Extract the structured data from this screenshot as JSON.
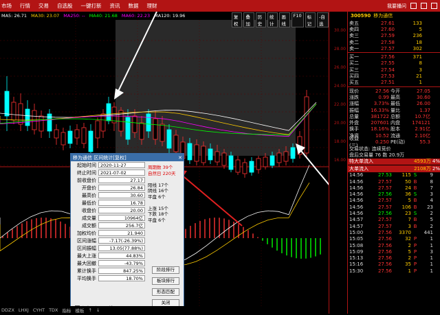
{
  "menu": [
    "市场",
    "行情",
    "交易",
    "自选股",
    "一键打新",
    "资讯",
    "数据",
    "理财"
  ],
  "topright": {
    "link": "我要播问"
  },
  "ma_legend": [
    {
      "text": "MA5: 26.71",
      "color": "#ffffff"
    },
    {
      "text": "MA30: 23.07",
      "color": "#ffcc00"
    },
    {
      "text": "MA250: --",
      "color": "#ff00ff"
    },
    {
      "text": "MA40: 21.68",
      "color": "#00ff00"
    },
    {
      "text": "MA60: 22.23",
      "color": "#ff00ff"
    },
    {
      "text": "MA120: 19.96",
      "color": "#ffffff"
    }
  ],
  "chart_buttons": [
    "复权",
    "叠加",
    "历史",
    "统计",
    "画线",
    "F10",
    "标记",
    "-自选"
  ],
  "axis_ticks": [
    "30.00",
    "28.00",
    "26.00",
    "24.00",
    "22.00",
    "20.00",
    "18.00",
    "16.00"
  ],
  "stock": {
    "code": "300590",
    "name": "移为通信"
  },
  "asks": [
    {
      "label": "卖五",
      "price": "27.61",
      "vol": "133"
    },
    {
      "label": "卖四",
      "price": "27.60",
      "vol": "5"
    },
    {
      "label": "卖三",
      "price": "27.59",
      "vol": "236"
    },
    {
      "label": "卖二",
      "price": "27.58",
      "vol": "18"
    },
    {
      "label": "卖一",
      "price": "27.57",
      "vol": "302"
    }
  ],
  "bids": [
    {
      "label": "买一",
      "price": "27.56",
      "vol": "371"
    },
    {
      "label": "买二",
      "price": "27.55",
      "vol": "8"
    },
    {
      "label": "买三",
      "price": "27.54",
      "vol": "3"
    },
    {
      "label": "买四",
      "price": "27.53",
      "vol": "21"
    },
    {
      "label": "买五",
      "price": "27.51",
      "vol": "1"
    }
  ],
  "quote": [
    {
      "a": "现价",
      "b": "27.56",
      "c": "今开",
      "d": "27.05"
    },
    {
      "a": "涨跌",
      "b": "0.99",
      "c": "最高",
      "d": "30.60"
    },
    {
      "a": "涨幅",
      "b": "3.73%",
      "c": "最低",
      "d": "26.00"
    },
    {
      "a": "振幅",
      "b": "16.33%",
      "c": "量比",
      "d": "1.37"
    },
    {
      "a": "总量",
      "b": "381722",
      "c": "总额",
      "d": "10.7亿"
    },
    {
      "a": "外盘",
      "b": "207601",
      "c": "内盘",
      "d": "174121"
    },
    {
      "a": "换手",
      "b": "18.16%",
      "c": "股本",
      "d": "2.91亿"
    },
    {
      "a": "净资",
      "b": "10.52",
      "c": "流通",
      "d": "2.10亿"
    },
    {
      "a": "收益(三)",
      "b": "0.250",
      "c": "PE(动)",
      "d": "55.3"
    }
  ],
  "status": {
    "line1": "交易状态: 连续竞价",
    "line2": "盘后交易量 76 数 20.9万"
  },
  "flow": [
    {
      "label": "特大单流入",
      "value": "4593万",
      "pct": "4%"
    },
    {
      "label": "大单流入",
      "value": "2108万",
      "pct": "2%"
    }
  ],
  "ticks": [
    {
      "t": "14:56",
      "p": "27.53",
      "v": "115",
      "k": "S",
      "n": "9"
    },
    {
      "t": "14:56",
      "p": "27.57",
      "v": "50",
      "k": "B",
      "n": "8"
    },
    {
      "t": "14:56",
      "p": "27.57",
      "v": "24",
      "k": "B",
      "n": "7"
    },
    {
      "t": "14:56",
      "p": "27.56",
      "v": "36",
      "k": "S",
      "n": "3"
    },
    {
      "t": "14:56",
      "p": "27.57",
      "v": "5",
      "k": "B",
      "n": "4"
    },
    {
      "t": "14:56",
      "p": "27.57",
      "v": "106",
      "k": "B",
      "n": "23"
    },
    {
      "t": "14:56",
      "p": "27.56",
      "v": "23",
      "k": "S",
      "n": "2"
    },
    {
      "t": "14:57",
      "p": "27.57",
      "v": "7",
      "k": "B",
      "n": "5"
    },
    {
      "t": "14:57",
      "p": "27.57",
      "v": "3",
      "k": "B",
      "n": "2"
    },
    {
      "t": "15:00",
      "p": "27.56",
      "v": "3370",
      "k": "",
      "n": "441"
    },
    {
      "t": "15:05",
      "p": "27.56",
      "v": "32",
      "k": "P",
      "n": "1"
    },
    {
      "t": "15:08",
      "p": "27.56",
      "v": "2",
      "k": "P",
      "n": "1"
    },
    {
      "t": "15:09",
      "p": "27.56",
      "v": "5",
      "k": "P",
      "n": "3"
    },
    {
      "t": "15:13",
      "p": "27.56",
      "v": "2",
      "k": "P",
      "n": "1"
    },
    {
      "t": "15:16",
      "p": "27.56",
      "v": "35",
      "k": "P",
      "n": "1"
    },
    {
      "t": "15:30",
      "p": "27.56",
      "v": "1",
      "k": "P",
      "n": "1"
    }
  ],
  "dialog": {
    "title": "移为通信 区间统计[复权]",
    "fields": [
      {
        "label": "起始时间",
        "value": "2020-11-27",
        "left": true
      },
      {
        "label": "终止时间",
        "value": "2021-07-02",
        "left": true
      },
      {
        "label": "前收盘价",
        "value": "27.17"
      },
      {
        "label": "开盘价",
        "value": "26.84"
      },
      {
        "label": "最高价",
        "value": "30.60"
      },
      {
        "label": "最低价",
        "value": "16.78"
      },
      {
        "label": "收盘价",
        "value": "20.00"
      },
      {
        "label": "成交量",
        "value": "10964亿"
      },
      {
        "label": "成交额",
        "value": "256.7亿"
      },
      {
        "label": "加权均价",
        "value": "21.940"
      },
      {
        "label": "区间涨幅",
        "value": "-7.17(-26.39%)"
      },
      {
        "label": "区间振幅",
        "value": "13.05(77.88%)"
      },
      {
        "label": "最大上涨",
        "value": "44.83%"
      },
      {
        "label": "最大回撤",
        "value": "-43.79%"
      },
      {
        "label": "累计换手",
        "value": "847.25%"
      },
      {
        "label": "平均换手",
        "value": "18.70%"
      }
    ],
    "side": [
      {
        "text": "周期数 39个",
        "red": true
      },
      {
        "text": "自然日 220天",
        "red": true
      },
      {
        "text": "",
        "red": false
      },
      {
        "text": "阳线 17个",
        "red": false
      },
      {
        "text": "阴线 16个",
        "red": false
      },
      {
        "text": "平盘 6个",
        "red": false
      },
      {
        "text": "",
        "red": false
      },
      {
        "text": "上涨 15个",
        "red": false
      },
      {
        "text": "下跌 18个",
        "red": false
      },
      {
        "text": "平盘 6个",
        "red": false
      }
    ],
    "buttons": [
      "阶段排行",
      "板块排行",
      "形态匹配",
      "关闭"
    ],
    "checkbox": "保留区间显示线"
  },
  "bottom_tabs": [
    "DDZX",
    "LHXJ",
    "CYHT",
    "TDX",
    "指标",
    "模板",
    "↑",
    "↓"
  ]
}
